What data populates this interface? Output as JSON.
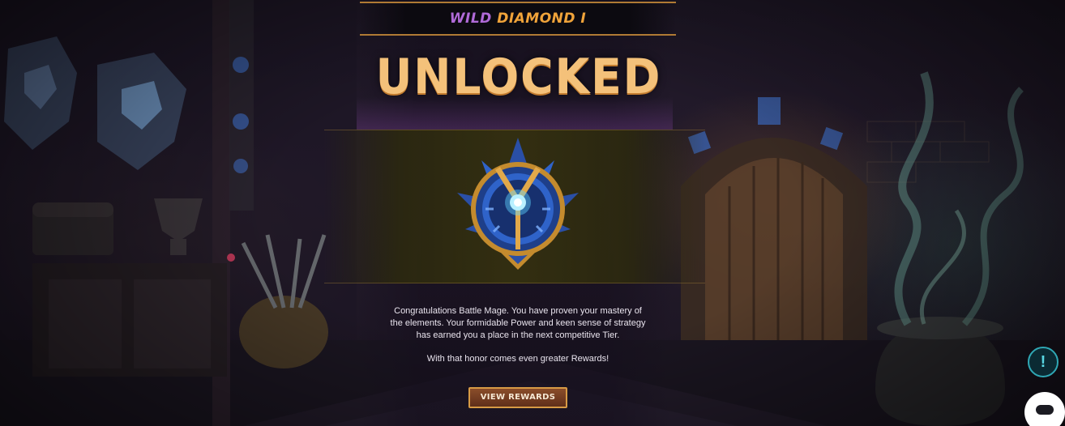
{
  "tier": {
    "prefix": "WILD",
    "rank": "DIAMOND I"
  },
  "headline": "UNLOCKED",
  "message": {
    "paragraph1": "Congratulations Battle Mage. You have proven your mastery of the elements. Your formidable Power and keen sense of strategy has earned you a place in the next competitive Tier.",
    "paragraph2": "With that honor comes even greater Rewards!"
  },
  "buttons": {
    "view_rewards": "VIEW REWARDS",
    "alert": "!"
  },
  "icons": {
    "emblem": "diamond-tier-emblem",
    "alert": "alert-icon",
    "chat": "chat-icon"
  },
  "colors": {
    "accent_gold": "#f4c17a",
    "tier_purple": "#b06ad8",
    "tier_orange": "#f0a33a",
    "emblem_blue": "#2f63c9",
    "button_border": "#d79a45"
  }
}
